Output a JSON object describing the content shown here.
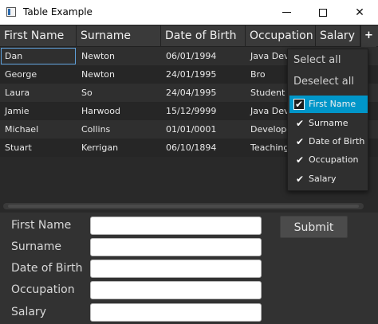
{
  "window": {
    "title": "Table Example"
  },
  "table": {
    "columns": [
      "First Name",
      "Surname",
      "Date of Birth",
      "Occupation",
      "Salary"
    ],
    "column_menu_button": "+",
    "rows": [
      [
        "Dan",
        "Newton",
        "06/01/1994",
        "Java Deve",
        ""
      ],
      [
        "George",
        "Newton",
        "24/01/1995",
        "Bro",
        ""
      ],
      [
        "Laura",
        "So",
        "24/04/1995",
        "Student",
        ""
      ],
      [
        "Jamie",
        "Harwood",
        "15/12/9999",
        "Java Deve",
        ""
      ],
      [
        "Michael",
        "Collins",
        "01/01/0001",
        "Developer",
        ""
      ],
      [
        "Stuart",
        "Kerrigan",
        "06/10/1894",
        "Teaching I",
        ""
      ]
    ]
  },
  "column_menu": {
    "select_all": "Select all",
    "deselect_all": "Deselect all",
    "options": [
      {
        "label": "First Name",
        "checked": true,
        "selected": true
      },
      {
        "label": "Surname",
        "checked": true,
        "selected": false
      },
      {
        "label": "Date of Birth",
        "checked": true,
        "selected": false
      },
      {
        "label": "Occupation",
        "checked": true,
        "selected": false
      },
      {
        "label": "Salary",
        "checked": true,
        "selected": false
      }
    ]
  },
  "form": {
    "fields": [
      {
        "label": "First Name",
        "value": ""
      },
      {
        "label": "Surname",
        "value": ""
      },
      {
        "label": "Date of Birth",
        "value": ""
      },
      {
        "label": "Occupation",
        "value": ""
      },
      {
        "label": "Salary",
        "value": ""
      }
    ],
    "submit_label": "Submit"
  }
}
